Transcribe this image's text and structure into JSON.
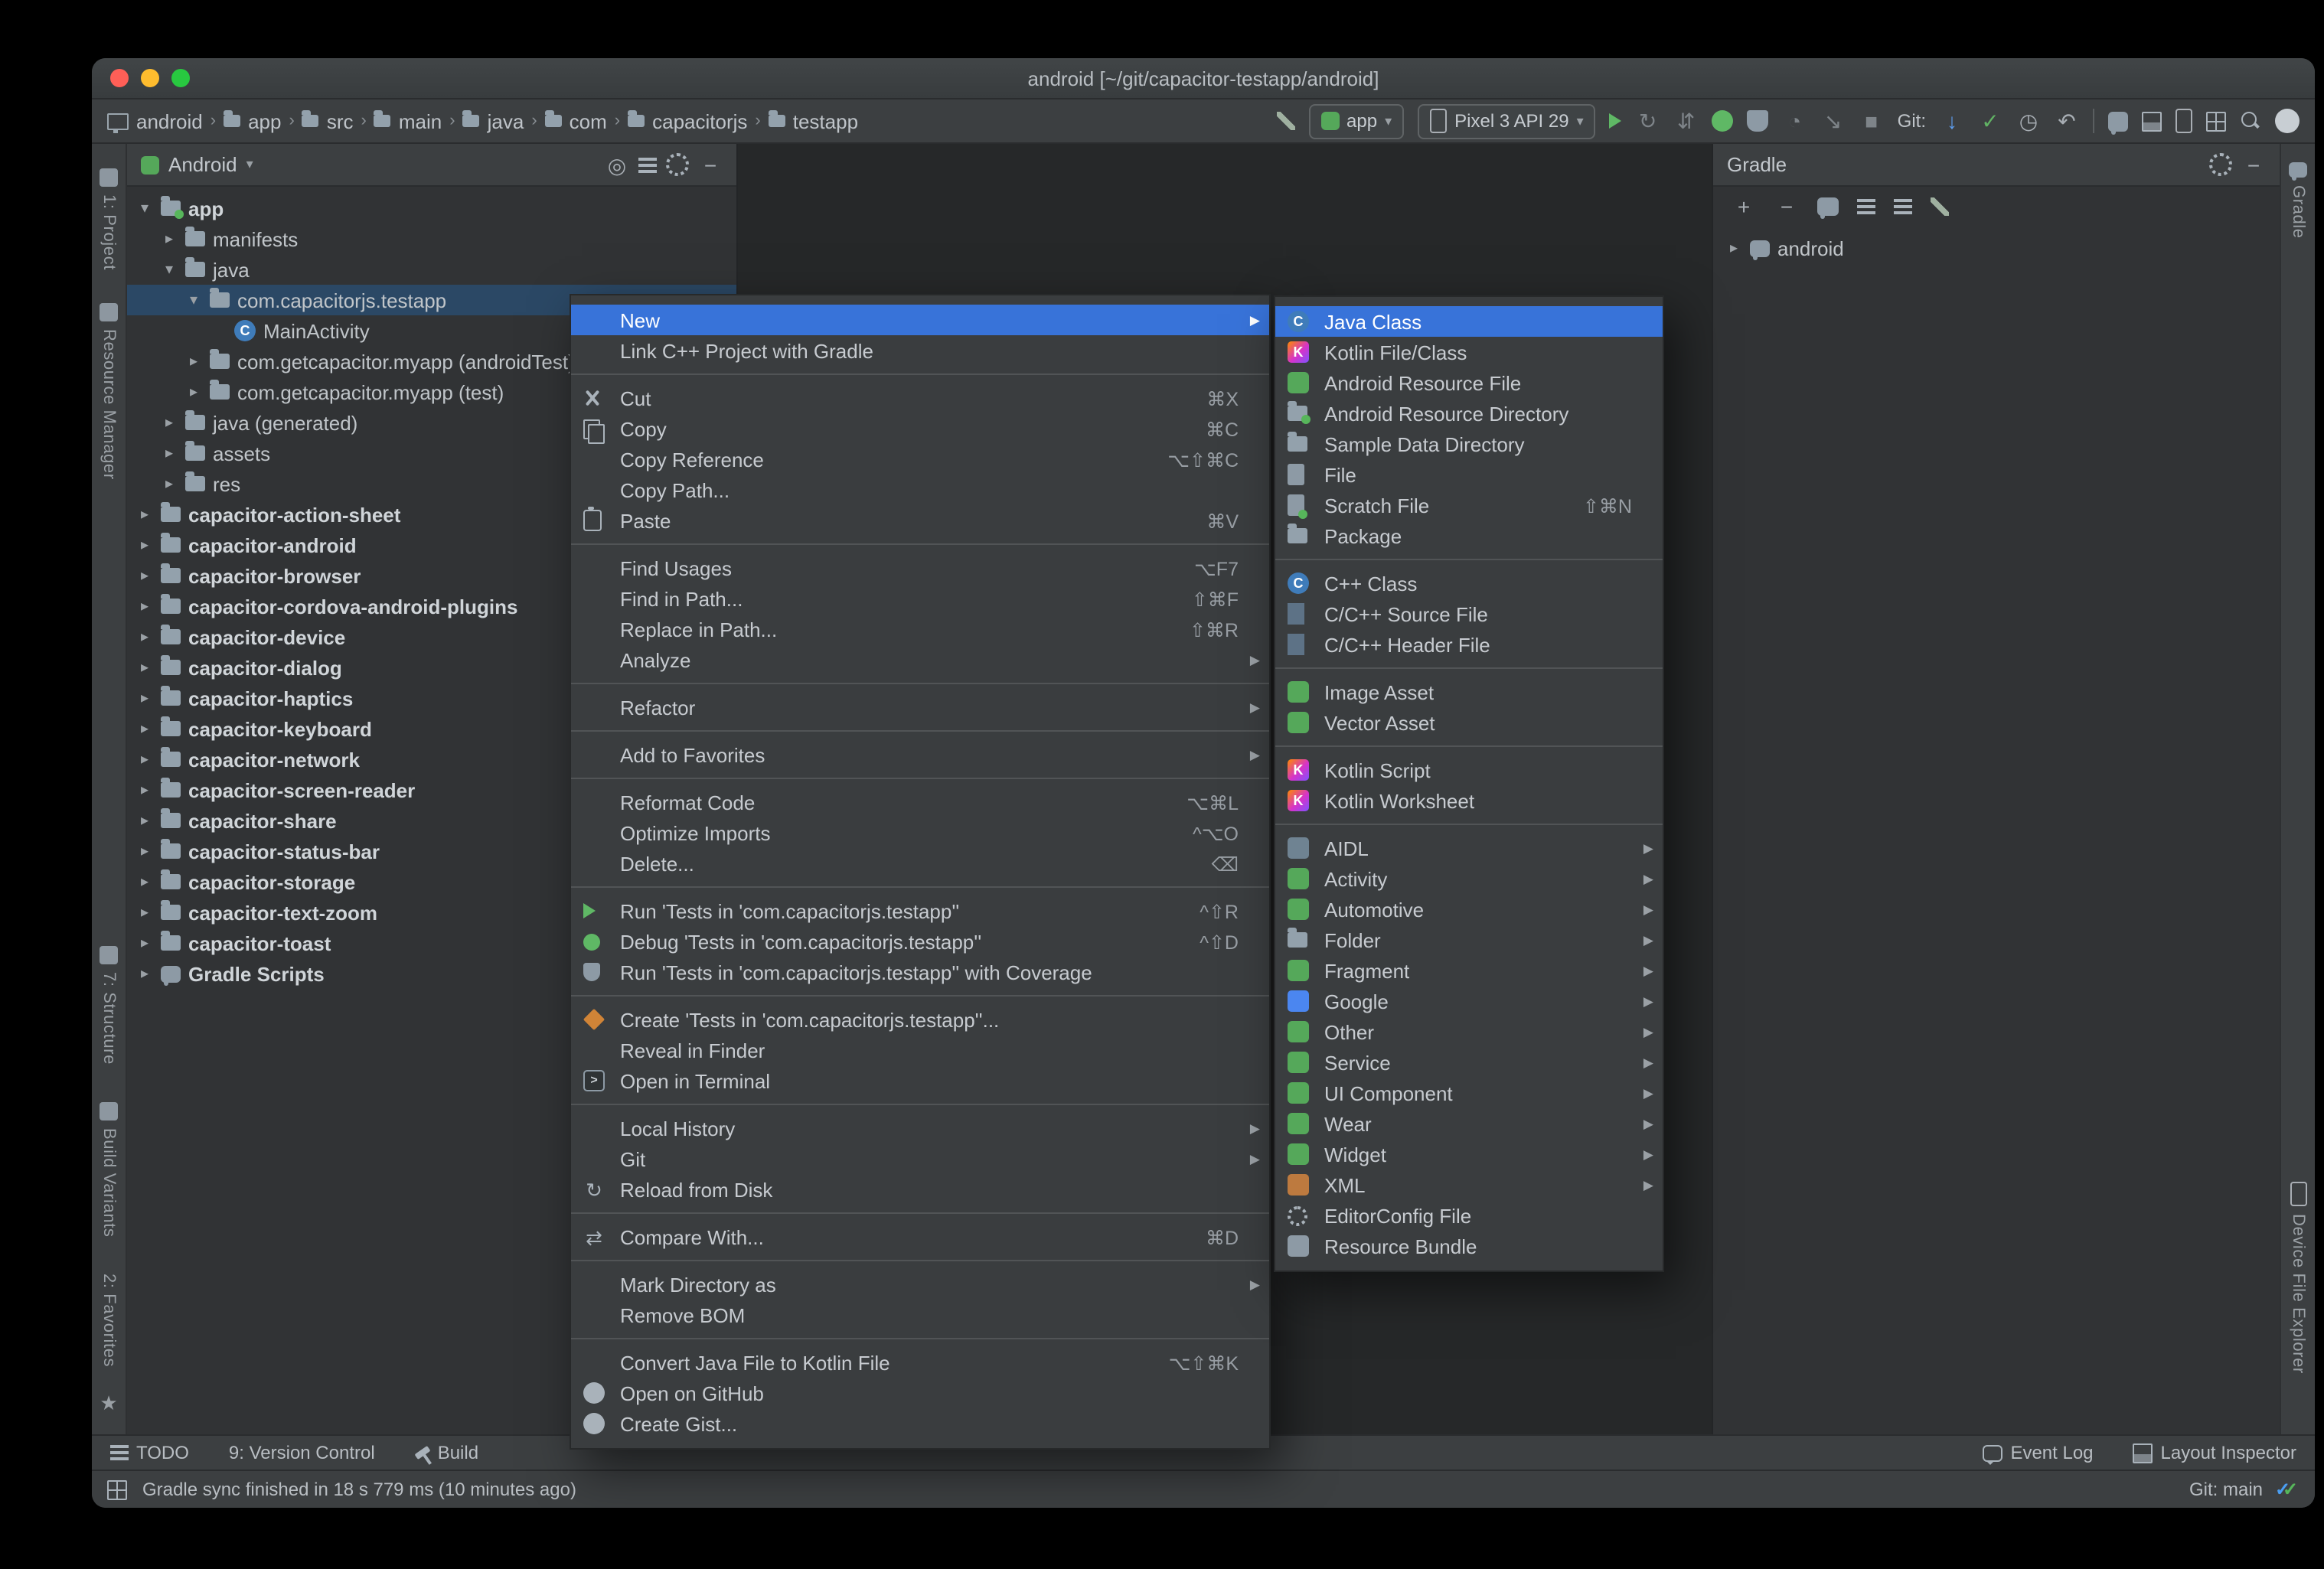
{
  "window": {
    "title": "android [~/git/capacitor-testapp/android]"
  },
  "colors": {
    "menu_selection_blue": "#3873d9",
    "tree_selection_blue": "#2b4865",
    "run_green": "#5fb865",
    "panel_bg": "#313335",
    "chrome_bg": "#3c3f41",
    "editor_bg": "#262829",
    "traffic_red": "#ff5f57",
    "traffic_yellow": "#febc2e",
    "traffic_green": "#28c840"
  },
  "icons": {
    "chevron": "›",
    "expanded": "▾",
    "collapsed": "▸",
    "submenu": "▶",
    "dropdown": "▾",
    "reload": "↻",
    "compare": "⇄",
    "history": "◷",
    "update": "↓",
    "commit": "✓",
    "rollback": "↶",
    "stop": "■",
    "gauge": "◔",
    "attach": "↘",
    "runtasks": "⇵",
    "minus": "−",
    "plus": "+",
    "locate": "◎",
    "star": "★",
    "check": "✓",
    "prompt": ">",
    "class_letter": "C",
    "kotlin_letter": "K",
    "header_letter": "H"
  },
  "toolbar": {
    "breadcrumbs": [
      "android",
      "app",
      "src",
      "main",
      "java",
      "com",
      "capacitorjs",
      "testapp"
    ],
    "run_config_label": "app",
    "device_label": "Pixel 3 API 29",
    "git_label": "Git:"
  },
  "stripes": {
    "left_top": [
      "1: Project",
      "Resource Manager"
    ],
    "left_bottom": [
      "7: Structure",
      "Build Variants",
      "2: Favorites"
    ],
    "right_top": [
      "Gradle"
    ],
    "right_bottom": [
      "Device File Explorer"
    ]
  },
  "project_panel": {
    "view_label": "Android",
    "tree": [
      {
        "label": "app",
        "level": 0,
        "state": "expanded",
        "bold": true
      },
      {
        "label": "manifests",
        "level": 1,
        "state": "collapsed"
      },
      {
        "label": "java",
        "level": 1,
        "state": "expanded"
      },
      {
        "label": "com.capacitorjs.testapp",
        "level": 2,
        "state": "expanded",
        "selected": true
      },
      {
        "label": "MainActivity",
        "level": 3,
        "state": "leaf"
      },
      {
        "label": "com.getcapacitor.myapp (androidTest)",
        "level": 2,
        "state": "collapsed"
      },
      {
        "label": "com.getcapacitor.myapp (test)",
        "level": 2,
        "state": "collapsed"
      },
      {
        "label": "java (generated)",
        "level": 1,
        "state": "collapsed"
      },
      {
        "label": "assets",
        "level": 1,
        "state": "collapsed"
      },
      {
        "label": "res",
        "level": 1,
        "state": "collapsed"
      },
      {
        "label": "capacitor-action-sheet",
        "level": 0,
        "state": "collapsed",
        "bold": true
      },
      {
        "label": "capacitor-android",
        "level": 0,
        "state": "collapsed",
        "bold": true
      },
      {
        "label": "capacitor-browser",
        "level": 0,
        "state": "collapsed",
        "bold": true
      },
      {
        "label": "capacitor-cordova-android-plugins",
        "level": 0,
        "state": "collapsed",
        "bold": true
      },
      {
        "label": "capacitor-device",
        "level": 0,
        "state": "collapsed",
        "bold": true
      },
      {
        "label": "capacitor-dialog",
        "level": 0,
        "state": "collapsed",
        "bold": true
      },
      {
        "label": "capacitor-haptics",
        "level": 0,
        "state": "collapsed",
        "bold": true
      },
      {
        "label": "capacitor-keyboard",
        "level": 0,
        "state": "collapsed",
        "bold": true
      },
      {
        "label": "capacitor-network",
        "level": 0,
        "state": "collapsed",
        "bold": true
      },
      {
        "label": "capacitor-screen-reader",
        "level": 0,
        "state": "collapsed",
        "bold": true
      },
      {
        "label": "capacitor-share",
        "level": 0,
        "state": "collapsed",
        "bold": true
      },
      {
        "label": "capacitor-status-bar",
        "level": 0,
        "state": "collapsed",
        "bold": true
      },
      {
        "label": "capacitor-storage",
        "level": 0,
        "state": "collapsed",
        "bold": true
      },
      {
        "label": "capacitor-text-zoom",
        "level": 0,
        "state": "collapsed",
        "bold": true
      },
      {
        "label": "capacitor-toast",
        "level": 0,
        "state": "collapsed",
        "bold": true
      },
      {
        "label": "Gradle Scripts",
        "level": 0,
        "state": "collapsed",
        "bold": true
      }
    ]
  },
  "gradle_panel": {
    "title": "Gradle",
    "tree": [
      {
        "label": "android",
        "state": "collapsed"
      }
    ]
  },
  "context_menu": {
    "items": [
      {
        "label": "New",
        "submenu": true,
        "selected": true
      },
      {
        "label": "Link C++ Project with Gradle"
      },
      {
        "label": "Cut",
        "shortcut": "⌘X"
      },
      {
        "label": "Copy",
        "shortcut": "⌘C"
      },
      {
        "label": "Copy Reference",
        "shortcut": "⌥⇧⌘C"
      },
      {
        "label": "Copy Path..."
      },
      {
        "label": "Paste",
        "shortcut": "⌘V"
      },
      {
        "label": "Find Usages",
        "shortcut": "⌥F7"
      },
      {
        "label": "Find in Path...",
        "shortcut": "⇧⌘F"
      },
      {
        "label": "Replace in Path...",
        "shortcut": "⇧⌘R"
      },
      {
        "label": "Analyze",
        "submenu": true
      },
      {
        "label": "Refactor",
        "submenu": true
      },
      {
        "label": "Add to Favorites",
        "submenu": true
      },
      {
        "label": "Reformat Code",
        "shortcut": "⌥⌘L"
      },
      {
        "label": "Optimize Imports",
        "shortcut": "^⌥O"
      },
      {
        "label": "Delete...",
        "shortcut": "⌫"
      },
      {
        "label": "Run 'Tests in 'com.capacitorjs.testapp''",
        "shortcut": "^⇧R"
      },
      {
        "label": "Debug 'Tests in 'com.capacitorjs.testapp''",
        "shortcut": "^⇧D"
      },
      {
        "label": "Run 'Tests in 'com.capacitorjs.testapp'' with Coverage"
      },
      {
        "label": "Create 'Tests in 'com.capacitorjs.testapp''..."
      },
      {
        "label": "Reveal in Finder"
      },
      {
        "label": "Open in Terminal"
      },
      {
        "label": "Local History",
        "submenu": true
      },
      {
        "label": "Git",
        "submenu": true
      },
      {
        "label": "Reload from Disk"
      },
      {
        "label": "Compare With...",
        "shortcut": "⌘D"
      },
      {
        "label": "Mark Directory as",
        "submenu": true
      },
      {
        "label": "Remove BOM"
      },
      {
        "label": "Convert Java File to Kotlin File",
        "shortcut": "⌥⇧⌘K"
      },
      {
        "label": "Open on GitHub"
      },
      {
        "label": "Create Gist..."
      }
    ]
  },
  "new_submenu": {
    "items": [
      {
        "label": "Java Class",
        "selected": true
      },
      {
        "label": "Kotlin File/Class"
      },
      {
        "label": "Android Resource File"
      },
      {
        "label": "Android Resource Directory"
      },
      {
        "label": "Sample Data Directory"
      },
      {
        "label": "File"
      },
      {
        "label": "Scratch File",
        "shortcut": "⇧⌘N"
      },
      {
        "label": "Package"
      },
      {
        "label": "C++ Class"
      },
      {
        "label": "C/C++ Source File"
      },
      {
        "label": "C/C++ Header File"
      },
      {
        "label": "Image Asset"
      },
      {
        "label": "Vector Asset"
      },
      {
        "label": "Kotlin Script"
      },
      {
        "label": "Kotlin Worksheet"
      },
      {
        "label": "AIDL",
        "submenu": true
      },
      {
        "label": "Activity",
        "submenu": true
      },
      {
        "label": "Automotive",
        "submenu": true
      },
      {
        "label": "Folder",
        "submenu": true
      },
      {
        "label": "Fragment",
        "submenu": true
      },
      {
        "label": "Google",
        "submenu": true
      },
      {
        "label": "Other",
        "submenu": true
      },
      {
        "label": "Service",
        "submenu": true
      },
      {
        "label": "UI Component",
        "submenu": true
      },
      {
        "label": "Wear",
        "submenu": true
      },
      {
        "label": "Widget",
        "submenu": true
      },
      {
        "label": "XML",
        "submenu": true
      },
      {
        "label": "EditorConfig File"
      },
      {
        "label": "Resource Bundle"
      }
    ]
  },
  "bottom_bar": {
    "todo": "TODO",
    "version_control": "9: Version Control",
    "build": "Build",
    "event_log": "Event Log",
    "layout_inspector": "Layout Inspector"
  },
  "status_bar": {
    "message": "Gradle sync finished in 18 s 779 ms (10 minutes ago)",
    "git": "Git: main"
  }
}
